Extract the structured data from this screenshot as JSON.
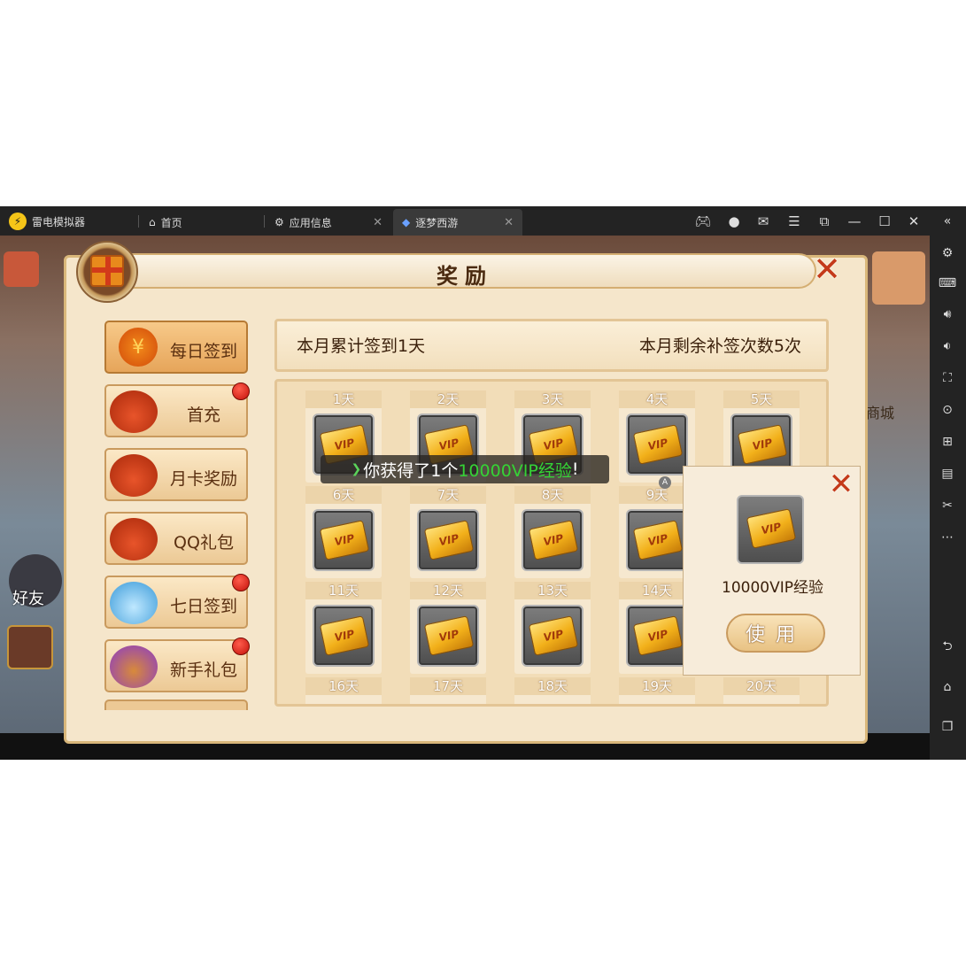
{
  "emulator": {
    "brand": "雷电模拟器",
    "tabs": [
      {
        "label": "首页",
        "icon": "home-icon"
      },
      {
        "label": "应用信息",
        "icon": "gear-icon"
      },
      {
        "label": "逐梦西游",
        "icon": "game-icon"
      }
    ]
  },
  "game": {
    "side_labels": {
      "friends": "好友",
      "shop": "商城"
    }
  },
  "reward": {
    "title": "奖励",
    "menu": [
      {
        "label": "每日签到",
        "icon": "sign-in-bag-icon",
        "red_dot": false,
        "active": true
      },
      {
        "label": "首充",
        "icon": "money-bag-icon",
        "red_dot": true,
        "active": false
      },
      {
        "label": "月卡奖励",
        "icon": "money-bag-icon",
        "red_dot": false,
        "active": false
      },
      {
        "label": "QQ礼包",
        "icon": "money-bag-icon",
        "red_dot": false,
        "active": false
      },
      {
        "label": "七日签到",
        "icon": "blue-treasure-icon",
        "red_dot": true,
        "active": false
      },
      {
        "label": "新手礼包",
        "icon": "purple-gift-icon",
        "red_dot": true,
        "active": false
      }
    ],
    "info": {
      "left": "本月累计签到1天",
      "right": "本月剩余补签次数5次"
    },
    "days": [
      "1天",
      "2天",
      "3天",
      "4天",
      "5天",
      "6天",
      "7天",
      "8天",
      "9天",
      "11天",
      "12天",
      "13天",
      "14天",
      "16天",
      "17天",
      "18天",
      "19天",
      "20天"
    ],
    "toast": {
      "prefix": "你获得了1个",
      "highlight": "10000VIP经验",
      "suffix": "!"
    },
    "popup": {
      "item_name": "10000VIP经验",
      "use_label": "使用"
    }
  }
}
